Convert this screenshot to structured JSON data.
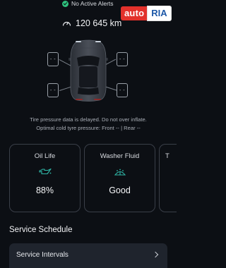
{
  "status": {
    "alerts_text": "No Active Alerts"
  },
  "watermark": {
    "part1": "auto",
    "part2": "RIA"
  },
  "odometer": {
    "value": "120 645 km",
    "icon": "speedometer-icon"
  },
  "tyres": {
    "front_left": "- -",
    "front_right": "- -",
    "rear_left": "- -",
    "rear_right": "- -",
    "note_line1": "Tire pressure data is delayed. Do not over inflate.",
    "note_line2": "Optimal cold tyre pressure: Front -- | Rear --"
  },
  "cards": {
    "oil": {
      "title": "Oil Life",
      "value": "88%",
      "icon": "oil-can-icon"
    },
    "washer": {
      "title": "Washer Fluid",
      "value": "Good",
      "icon": "washer-fluid-icon"
    },
    "third": {
      "title": "T"
    }
  },
  "service": {
    "section_title": "Service Schedule",
    "items": [
      {
        "label": "Service Intervals"
      }
    ]
  },
  "colors": {
    "background": "#0c0f14",
    "accent_teal": "#2fb8a8",
    "status_green": "#2ec27e",
    "card_border": "#3a3f48",
    "list_bg": "#1f242d"
  }
}
